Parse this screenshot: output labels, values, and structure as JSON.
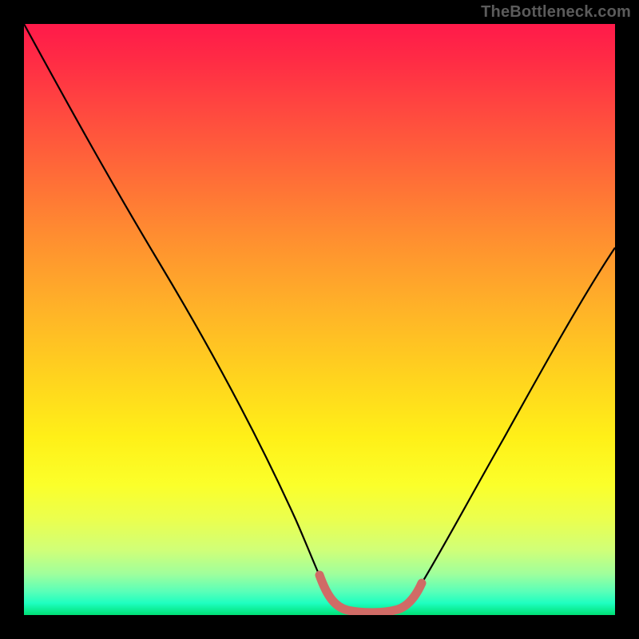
{
  "watermark": "TheBottleneck.com",
  "chart_data": {
    "type": "line",
    "title": "",
    "xlabel": "",
    "ylabel": "",
    "xlim": [
      0,
      100
    ],
    "ylim": [
      0,
      100
    ],
    "grid": false,
    "series": [
      {
        "name": "bottleneck-curve",
        "color": "#000000",
        "x": [
          0,
          5,
          10,
          15,
          20,
          25,
          30,
          35,
          40,
          45,
          48,
          50,
          52,
          55,
          57,
          60,
          63,
          67,
          70,
          75,
          80,
          85,
          90,
          95,
          100
        ],
        "y": [
          100,
          92,
          83,
          74,
          65,
          56,
          47,
          38,
          29,
          19,
          11,
          5,
          2,
          1,
          1,
          1,
          2,
          6,
          11,
          20,
          30,
          41,
          52,
          62,
          67
        ]
      },
      {
        "name": "optimal-band",
        "color": "#d06b66",
        "x": [
          48,
          50,
          52,
          55,
          57,
          60,
          63
        ],
        "y": [
          11,
          5,
          2,
          1,
          1,
          1,
          2
        ]
      }
    ],
    "annotations": []
  }
}
